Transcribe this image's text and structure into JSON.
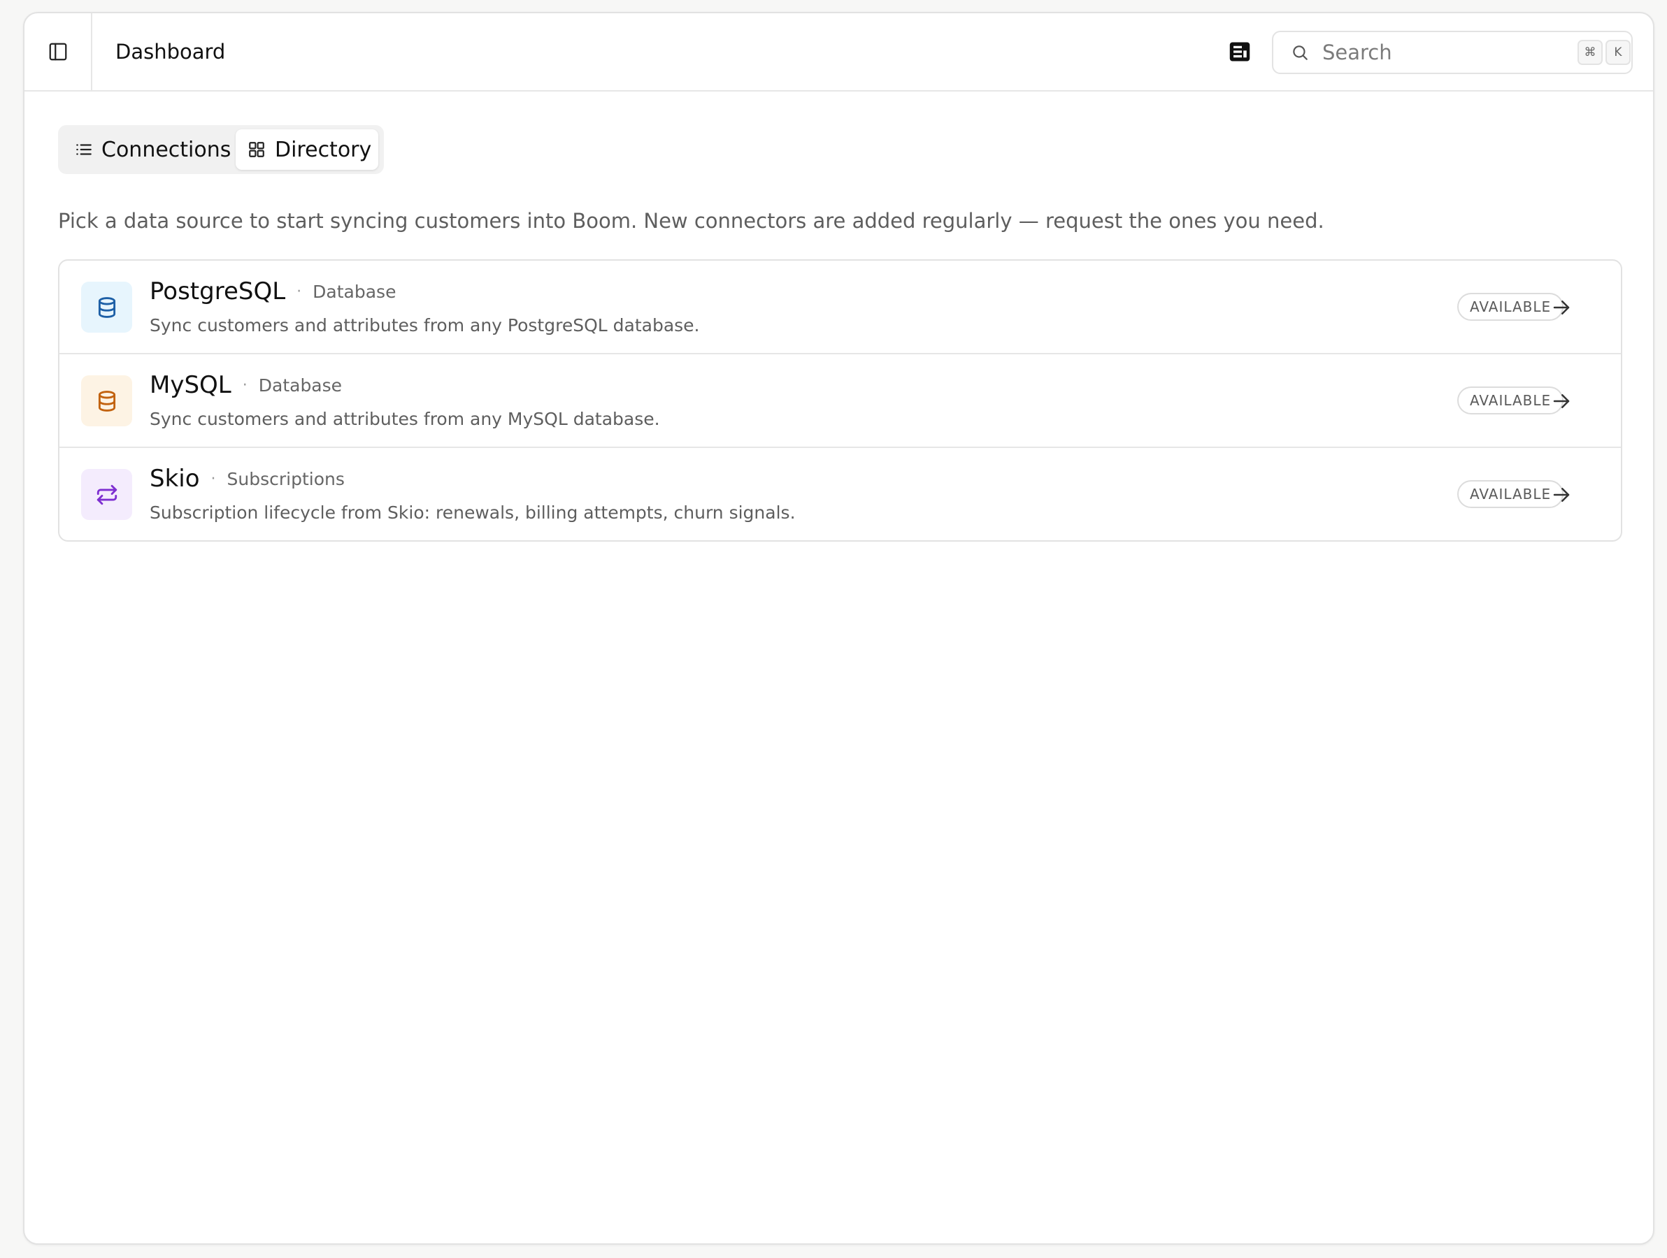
{
  "header": {
    "title": "Dashboard",
    "search": {
      "placeholder": "Search",
      "shortcut_keys": [
        "⌘",
        "K"
      ]
    }
  },
  "tabs": [
    {
      "label": "Connections",
      "icon": "list-icon",
      "active": false
    },
    {
      "label": "Directory",
      "icon": "grid-icon",
      "active": true
    }
  ],
  "description": "Pick a data source to start syncing customers into Boom. New connectors are added regularly — request the ones you need.",
  "connectors": [
    {
      "name": "PostgreSQL",
      "separator": "·",
      "category": "Database",
      "summary": "Sync customers and attributes from any PostgreSQL database.",
      "status": "AVAILABLE",
      "icon": "database-icon",
      "icon_color": "#1d5fa6",
      "icon_bg": "#e7f5fd"
    },
    {
      "name": "MySQL",
      "separator": "·",
      "category": "Database",
      "summary": "Sync customers and attributes from any MySQL database.",
      "status": "AVAILABLE",
      "icon": "database-icon",
      "icon_color": "#c2620f",
      "icon_bg": "#fdf3e4"
    },
    {
      "name": "Skio",
      "separator": "·",
      "category": "Subscriptions",
      "summary": "Subscription lifecycle from Skio: renewals, billing attempts, churn signals.",
      "status": "AVAILABLE",
      "icon": "repeat-icon",
      "icon_color": "#7e2fd1",
      "icon_bg": "#f4ecfd"
    }
  ]
}
